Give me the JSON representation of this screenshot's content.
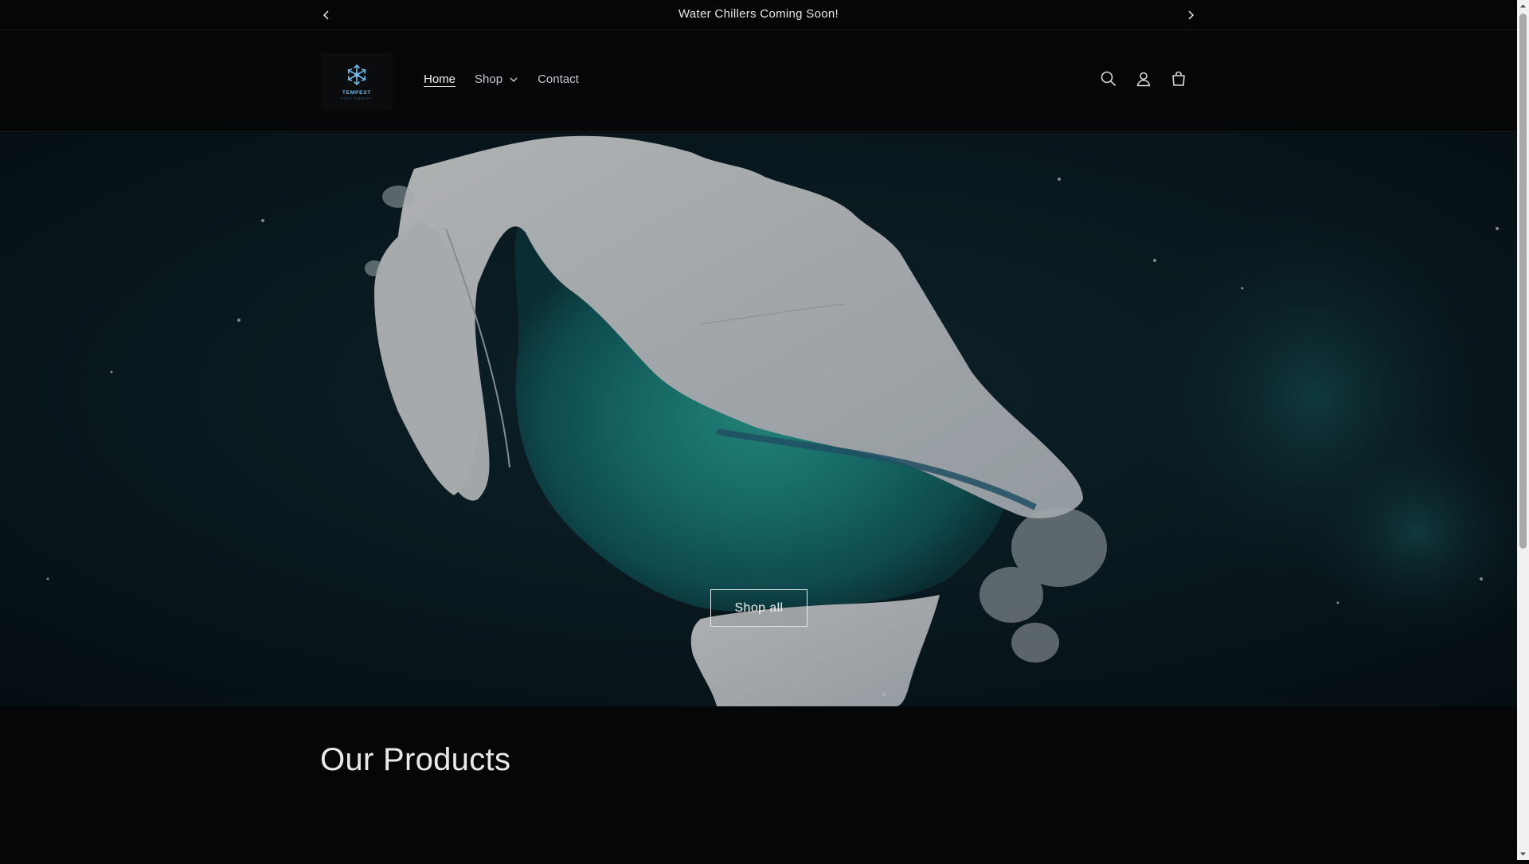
{
  "announcement": {
    "text": "Water Chillers Coming Soon!",
    "prev_icon": "chevron-left-icon",
    "next_icon": "chevron-right-icon"
  },
  "header": {
    "logo_text": "TEMPEST",
    "logo_subtext": "COLD THERAPY",
    "nav": [
      {
        "label": "Home",
        "active": true
      },
      {
        "label": "Shop",
        "has_dropdown": true
      },
      {
        "label": "Contact"
      }
    ],
    "icons": [
      "search-icon",
      "account-icon",
      "cart-icon"
    ]
  },
  "hero": {
    "image": "aerial view of iceberg in dark ocean",
    "button_label": "Shop all"
  },
  "products": {
    "title": "Our Products"
  },
  "colors": {
    "background": "#050607",
    "text": "#e9ecef",
    "accent_teal": "#1f8f8a",
    "logo_blue": "#6fb7e6"
  }
}
